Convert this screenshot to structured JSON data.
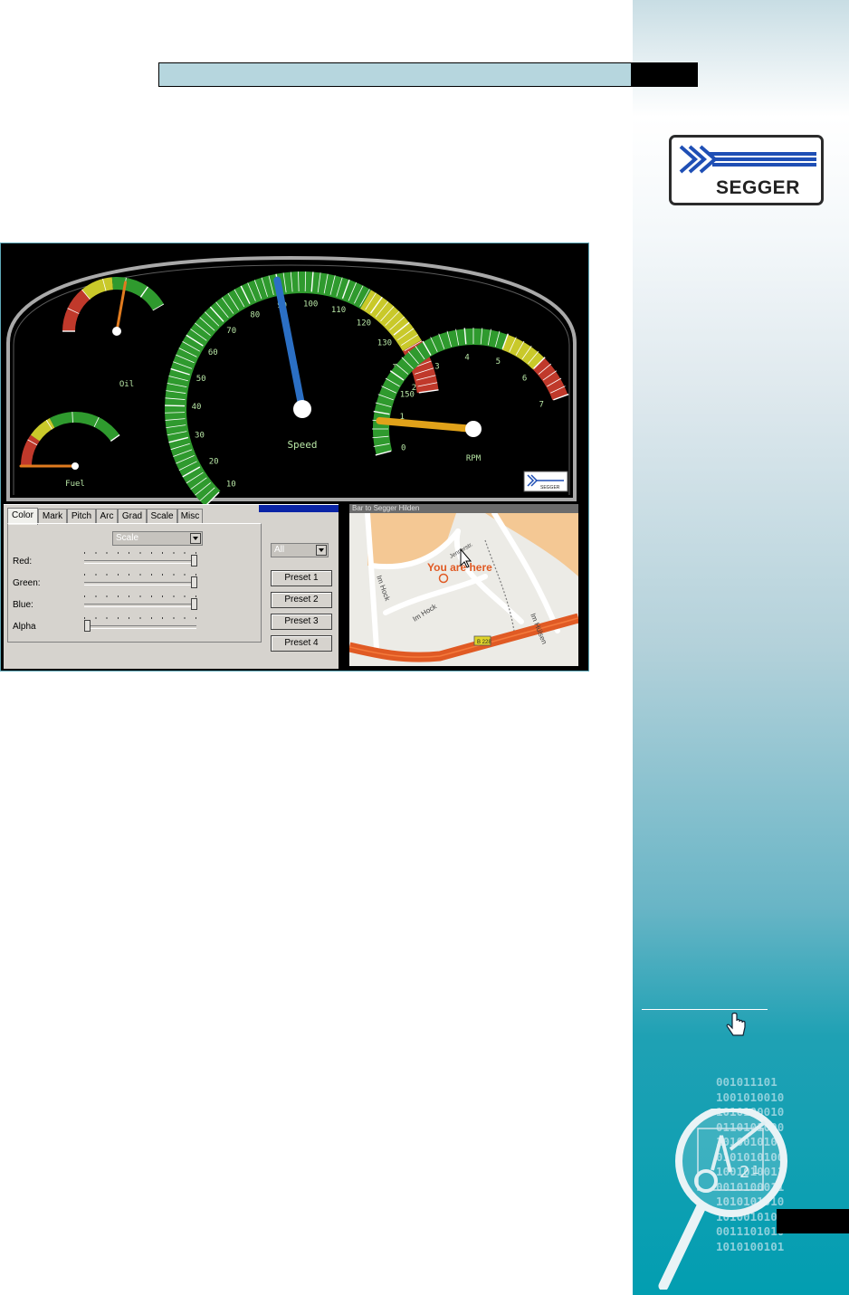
{
  "dashboard": {
    "gauges": [
      {
        "name": "Oil",
        "label": "Oil"
      },
      {
        "name": "Fuel",
        "label": "Fuel"
      },
      {
        "name": "Speed",
        "label": "Speed",
        "ticks": [
          "10",
          "20",
          "30",
          "40",
          "50",
          "60",
          "70",
          "80",
          "90",
          "100",
          "110",
          "120",
          "130",
          "140",
          "150"
        ],
        "value": 90
      },
      {
        "name": "RPM",
        "label": "RPM",
        "ticks": [
          "0",
          "1",
          "2",
          "3",
          "4",
          "5",
          "6",
          "7"
        ],
        "value": 0.8
      }
    ],
    "colors": {
      "green": "#2f9a2e",
      "yellow": "#c9c92a",
      "red": "#c0392b",
      "needle_speed": "#2b6fc4",
      "needle_rpm": "#e1a21a"
    }
  },
  "settings": {
    "tabs": [
      "Color",
      "Mark",
      "Pitch",
      "Arc",
      "Grad",
      "Scale",
      "Misc"
    ],
    "active_tab": "Color",
    "scale_combo": "Scale",
    "target_combo": "All",
    "sliders": [
      {
        "label": "Red:",
        "value": 1.0
      },
      {
        "label": "Green:",
        "value": 1.0
      },
      {
        "label": "Blue:",
        "value": 1.0
      },
      {
        "label": "Alpha",
        "value": 0.0
      }
    ],
    "presets": [
      "Preset 1",
      "Preset 2",
      "Preset 3",
      "Preset 4"
    ]
  },
  "map": {
    "title": "Bar to Segger Hilden",
    "marker_text": "You are here",
    "streets": [
      "Im Hock",
      "Im Hock",
      "Im Hülsen",
      "Jennerstr."
    ],
    "road_badge": "B 228"
  },
  "logo": {
    "text": "SEGGER"
  },
  "sidebar": {
    "binary_lines": [
      "001011101",
      "1001010010",
      "1010100010",
      "0110101000",
      "1010010101",
      "0101010100",
      "1001010011",
      "0010100011",
      "1010101010",
      "1010010101",
      "0011101010",
      "1010100101"
    ]
  }
}
